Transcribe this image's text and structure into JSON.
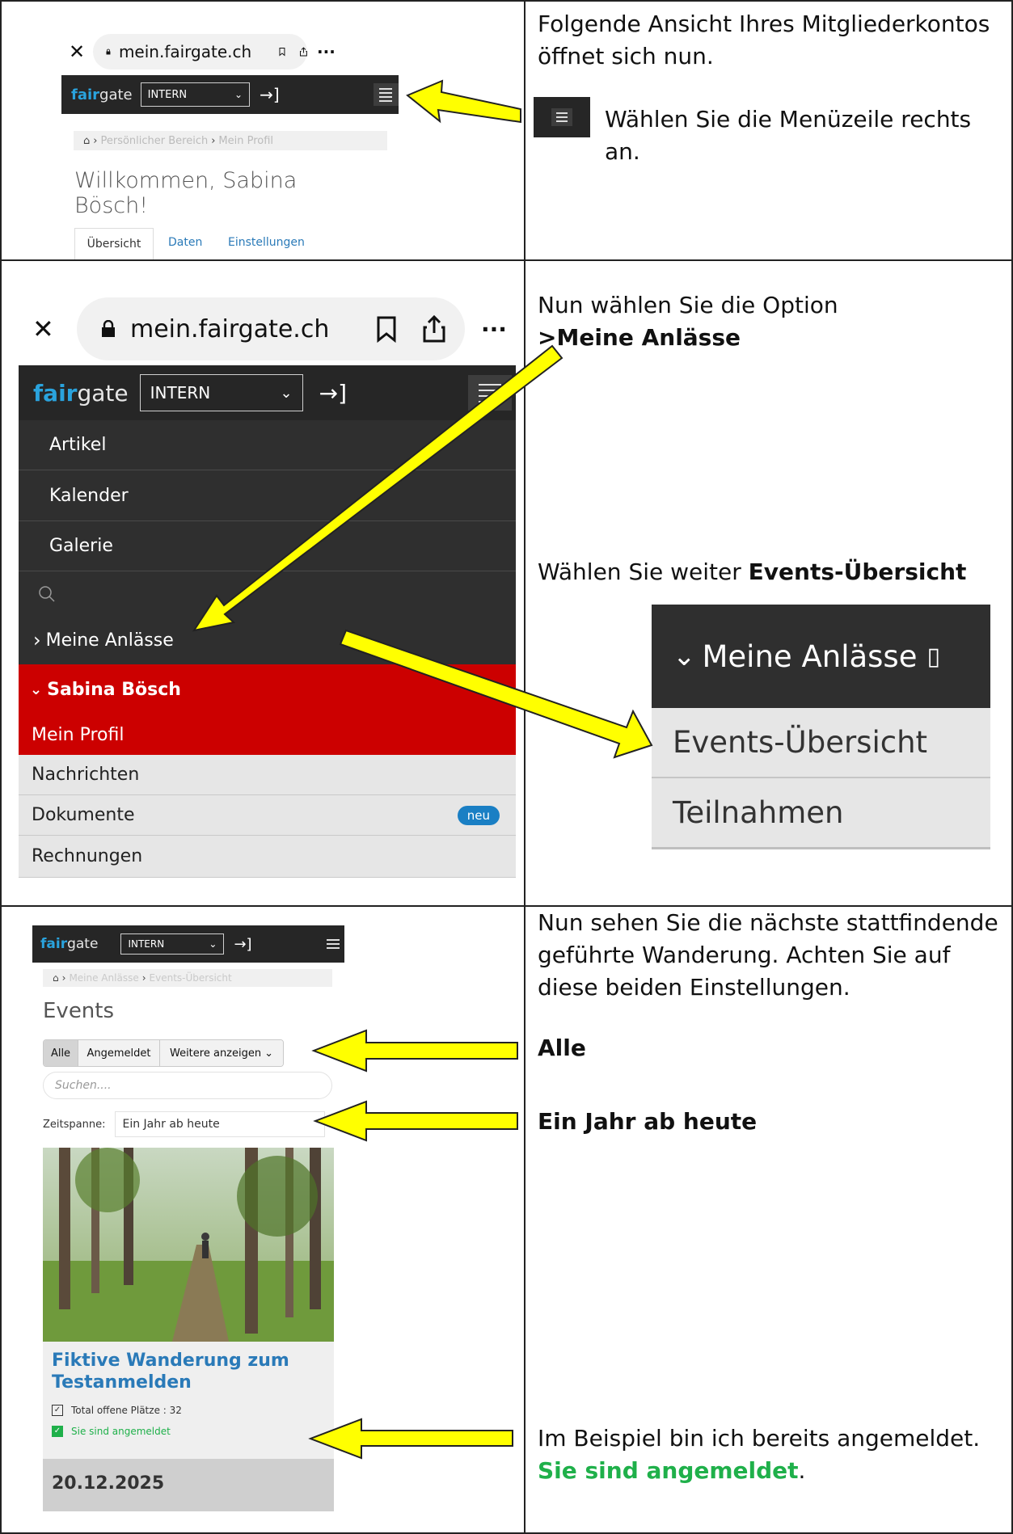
{
  "row1": {
    "browser": {
      "url": "mein.fairgate.ch",
      "close_icon": "close-icon",
      "lock_icon": "lock-icon",
      "bookmark_icon": "bookmark-icon",
      "share_icon": "share-icon",
      "more_label": "···"
    },
    "header": {
      "logo_fair": "fair",
      "logo_gate": "gate",
      "select_value": "INTERN",
      "login_icon": "login-arrow-icon",
      "menu_icon": "hamburger-icon"
    },
    "breadcrumb": {
      "home_icon": "home-icon",
      "items": [
        "Persönlicher Bereich",
        "Mein Profil"
      ]
    },
    "welcome": "Willkommen, Sabina Bösch!",
    "tabs": [
      "Übersicht",
      "Daten",
      "Einstellungen"
    ],
    "instruction_1": "Folgende Ansicht Ihres Mitgliederkontos öffnet sich nun.",
    "instruction_2": "Wählen Sie die Menüzeile rechts an."
  },
  "row2": {
    "browser": {
      "url": "mein.fairgate.ch",
      "more_label": "···"
    },
    "header": {
      "logo_fair": "fair",
      "logo_gate": "gate",
      "select_value": "INTERN"
    },
    "menu": {
      "dark_items": [
        "Artikel",
        "Kalender",
        "Galerie"
      ],
      "search_icon": "search-icon",
      "anlaesse": "Meine Anlässe",
      "user": "Sabina Bösch",
      "profile": "Mein Profil",
      "light_items": [
        "Nachrichten",
        "Dokumente",
        "Rechnungen"
      ],
      "badge": "neu"
    },
    "instruction_1": "Nun wählen Sie die Option",
    "instruction_1_bold": ">Meine Anlässe",
    "instruction_2": "Wählen Sie weiter ",
    "instruction_2_bold": "Events-Übersicht",
    "zoom": {
      "title": "Meine Anlässe",
      "glyph": "▯",
      "items": [
        "Events-Übersicht",
        "Teilnahmen"
      ]
    }
  },
  "row3": {
    "header": {
      "logo_fair": "fair",
      "logo_gate": "gate",
      "select_value": "INTERN"
    },
    "breadcrumb": [
      "Meine Anlässe",
      "Events-Übersicht"
    ],
    "title": "Events",
    "filters": [
      "Alle",
      "Angemeldet",
      "Weitere anzeigen"
    ],
    "search_placeholder": "Suchen....",
    "zeitspanne_label": "Zeitspanne:",
    "zeitspanne_value": "Ein Jahr ab heute",
    "event": {
      "title": "Fiktive Wanderung zum Testanmelden",
      "places": "Total offene Plätze : 32",
      "registered": "Sie sind angemeldet",
      "date": "20.12.2025"
    },
    "instruction_1": "Nun sehen Sie die nächste stattfindende geführte Wanderung. Achten Sie auf diese beiden Einstellungen.",
    "label_alle": "Alle",
    "label_zeit": "Ein Jahr ab heute",
    "instruction_2": "Im Beispiel bin ich bereits angemeldet.",
    "instruction_2_green": "Sie sind angemeldet",
    "instruction_2_end": "."
  },
  "colors": {
    "arrow_fill": "#ffff00",
    "accent_red": "#cc0000",
    "fair_blue": "#2aa3dd",
    "link_blue": "#2a7ab8",
    "green": "#1fb04a"
  }
}
